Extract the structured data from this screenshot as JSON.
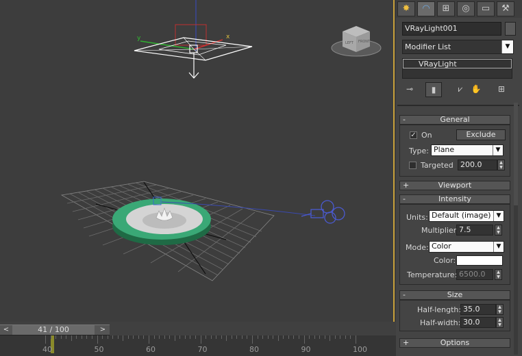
{
  "viewport": {
    "gizmo_labels": {
      "x": "x",
      "y": "y"
    },
    "viewcube_faces": {
      "left": "LEFT",
      "front": "FRONT"
    }
  },
  "timeline": {
    "prev": "<",
    "next": ">",
    "frame_display": "41 / 100",
    "ticks": [
      "40",
      "50",
      "60",
      "70",
      "80",
      "90",
      "100"
    ]
  },
  "panel": {
    "tabs": [
      {
        "name": "create",
        "glyph": "✸"
      },
      {
        "name": "modify",
        "glyph": "◠"
      },
      {
        "name": "hierarchy",
        "glyph": "⊞"
      },
      {
        "name": "motion",
        "glyph": "◎"
      },
      {
        "name": "display",
        "glyph": "▭"
      },
      {
        "name": "utilities",
        "glyph": "⚒"
      }
    ],
    "object_name": "VRayLight001",
    "object_color": "#5a5a5a",
    "modifier_list": "Modifier List",
    "stack_items": [
      "VRayLight"
    ],
    "rollouts": {
      "general": {
        "title": "General",
        "toggle": "-",
        "on_label": "On",
        "on_checked": "✓",
        "exclude_label": "Exclude",
        "type_label": "Type:",
        "type_value": "Plane",
        "targeted_label": "Targeted",
        "targeted_value": "200.0"
      },
      "viewport": {
        "title": "Viewport",
        "toggle": "+"
      },
      "intensity": {
        "title": "Intensity",
        "toggle": "-",
        "units_label": "Units:",
        "units_value": "Default (image)",
        "multiplier_label": "Multiplier:",
        "multiplier_value": "7.5",
        "mode_label": "Mode:",
        "mode_value": "Color",
        "color_label": "Color:",
        "color_value": "#ffffff",
        "temperature_label": "Temperature:",
        "temperature_value": "6500.0"
      },
      "size": {
        "title": "Size",
        "toggle": "-",
        "half_length_label": "Half-length:",
        "half_length_value": "35.0",
        "half_width_label": "Half-width:",
        "half_width_value": "30.0"
      },
      "options": {
        "title": "Options",
        "toggle": "+"
      }
    }
  }
}
